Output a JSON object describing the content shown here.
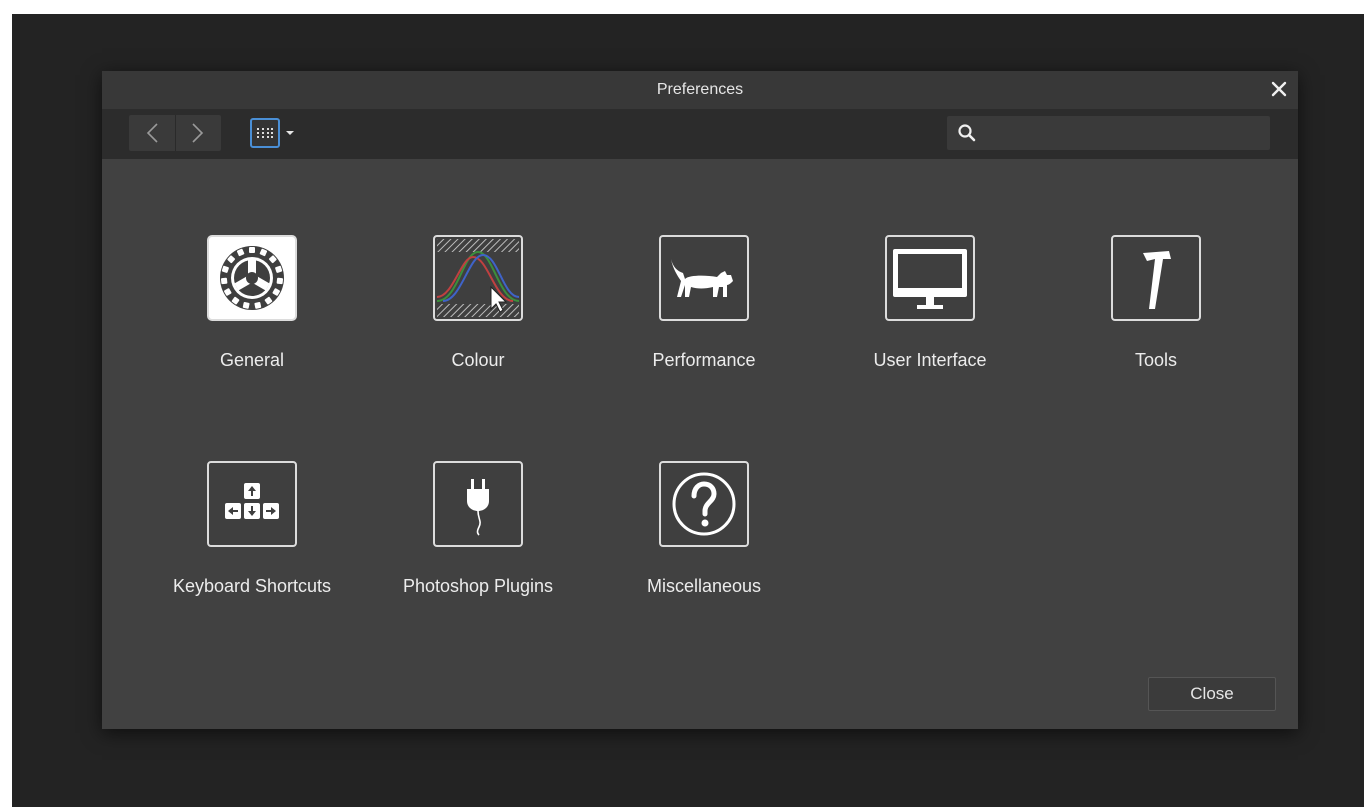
{
  "window": {
    "title": "Preferences"
  },
  "toolbar": {
    "back_icon": "chevron-left-icon",
    "forward_icon": "chevron-right-icon",
    "view_icon": "grid-icon",
    "search_placeholder": "",
    "search_value": ""
  },
  "categories": [
    {
      "label": "General",
      "icon": "gear-icon"
    },
    {
      "label": "Colour",
      "icon": "colour-curves-icon"
    },
    {
      "label": "Performance",
      "icon": "cat-icon"
    },
    {
      "label": "User Interface",
      "icon": "monitor-icon"
    },
    {
      "label": "Tools",
      "icon": "hammer-icon"
    },
    {
      "label": "Keyboard Shortcuts",
      "icon": "arrow-keys-icon"
    },
    {
      "label": "Photoshop Plugins",
      "icon": "plug-icon"
    },
    {
      "label": "Miscellaneous",
      "icon": "question-icon"
    }
  ],
  "footer": {
    "close_label": "Close"
  },
  "colors": {
    "accent": "#4a8fd6",
    "dialog": "#414141",
    "backdrop": "#232323"
  }
}
